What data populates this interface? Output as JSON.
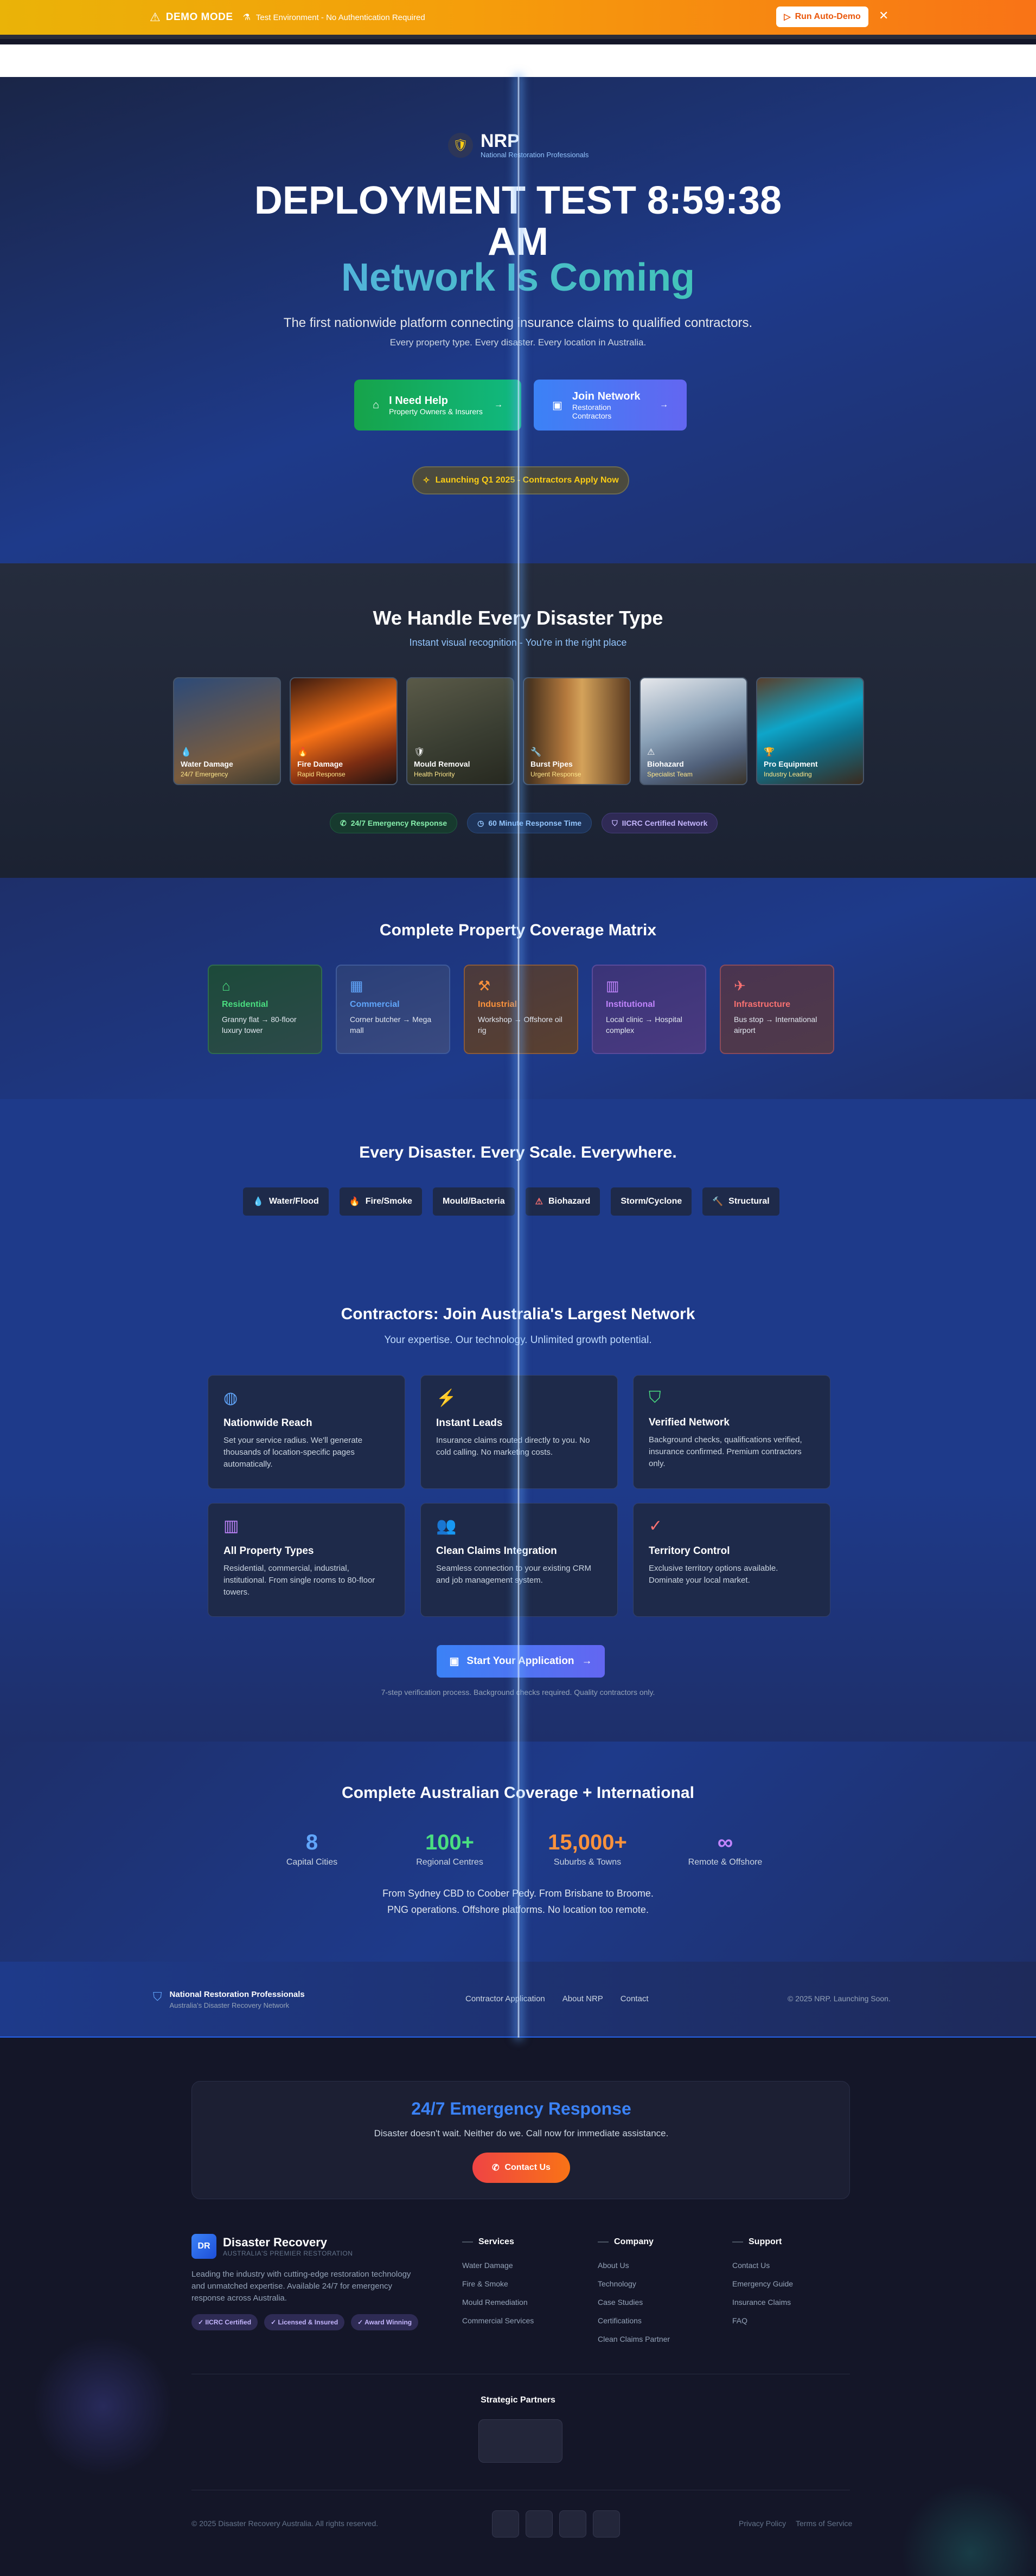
{
  "banner": {
    "mode": "DEMO MODE",
    "env": "Test Environment - No Authentication Required",
    "run_btn": "Run Auto-Demo"
  },
  "hero": {
    "logo_name": "NRP",
    "logo_sub": "National Restoration Professionals",
    "title_line1": "DEPLOYMENT TEST 8:59:38",
    "title_line2": "AM",
    "title_line3": "Network Is Coming",
    "lead": "The first nationwide platform connecting insurance claims to qualified contractors.",
    "lead2": "Every property type. Every disaster. Every location in Australia.",
    "cta1_title": "I Need Help",
    "cta1_sub": "Property Owners & Insurers",
    "cta2_title": "Join Network",
    "cta2_sub": "Restoration Contractors",
    "launch": "Launching Q1 2025 - Contractors Apply Now"
  },
  "disasters": {
    "title": "We Handle Every Disaster Type",
    "subtitle": "Instant visual recognition - You're in the right place",
    "tiles": [
      {
        "name": "Water Damage",
        "tag": "24/7 Emergency",
        "icon": "droplet-icon"
      },
      {
        "name": "Fire Damage",
        "tag": "Rapid Response",
        "icon": "flame-icon"
      },
      {
        "name": "Mould Removal",
        "tag": "Health Priority",
        "icon": "shield-icon"
      },
      {
        "name": "Burst Pipes",
        "tag": "Urgent Response",
        "icon": "wrench-icon"
      },
      {
        "name": "Biohazard",
        "tag": "Specialist Team",
        "icon": "warning-icon"
      },
      {
        "name": "Pro Equipment",
        "tag": "Industry Leading",
        "icon": "trophy-icon"
      }
    ],
    "badges": [
      "24/7 Emergency Response",
      "60 Minute Response Time",
      "IICRC Certified Network"
    ]
  },
  "matrix": {
    "title": "Complete Property Coverage Matrix",
    "cards": [
      {
        "name": "Residential",
        "desc": "Granny flat → 80-floor luxury tower"
      },
      {
        "name": "Commercial",
        "desc": "Corner butcher → Mega mall"
      },
      {
        "name": "Industrial",
        "desc": "Workshop → Offshore oil rig"
      },
      {
        "name": "Institutional",
        "desc": "Local clinic → Hospital complex"
      },
      {
        "name": "Infrastructure",
        "desc": "Bus stop → International airport"
      }
    ]
  },
  "everywhere": {
    "title": "Every Disaster. Every Scale. Everywhere.",
    "chips": [
      "Water/Flood",
      "Fire/Smoke",
      "Mould/Bacteria",
      "Biohazard",
      "Storm/Cyclone",
      "Structural"
    ]
  },
  "contractors": {
    "title": "Contractors: Join Australia's Largest Network",
    "subtitle": "Your expertise. Our technology. Unlimited growth potential.",
    "features": [
      {
        "title": "Nationwide Reach",
        "desc": "Set your service radius. We'll generate thousands of location-specific pages automatically."
      },
      {
        "title": "Instant Leads",
        "desc": "Insurance claims routed directly to you. No cold calling. No marketing costs."
      },
      {
        "title": "Verified Network",
        "desc": "Background checks, qualifications verified, insurance confirmed. Premium contractors only."
      },
      {
        "title": "All Property Types",
        "desc": "Residential, commercial, industrial, institutional. From single rooms to 80-floor towers."
      },
      {
        "title": "Clean Claims Integration",
        "desc": "Seamless connection to your existing CRM and job management system."
      },
      {
        "title": "Territory Control",
        "desc": "Exclusive territory options available. Dominate your local market."
      }
    ],
    "apply_btn": "Start Your Application",
    "note": "7-step verification process. Background checks required. Quality contractors only."
  },
  "coverage": {
    "title": "Complete Australian Coverage + International",
    "stats": [
      {
        "value": "8",
        "label": "Capital Cities",
        "color": "#60a5fa"
      },
      {
        "value": "100+",
        "label": "Regional Centres",
        "color": "#4ade80"
      },
      {
        "value": "15,000+",
        "label": "Suburbs & Towns",
        "color": "#fb923c"
      },
      {
        "value": "∞",
        "label": "Remote & Offshore",
        "color": "#c084fc"
      }
    ],
    "line1": "From Sydney CBD to Coober Pedy. From Brisbane to Broome.",
    "line2": "PNG operations. Offshore platforms. No location too remote."
  },
  "footer1": {
    "brand": "National Restoration Professionals",
    "brand_sub": "Australia's Disaster Recovery Network",
    "links": [
      "Contractor Application",
      "About NRP",
      "Contact"
    ],
    "copyright": "© 2025 NRP. Launching Soon."
  },
  "emergency": {
    "title": "24/7 Emergency Response",
    "desc": "Disaster doesn't wait. Neither do we. Call now for immediate assistance.",
    "btn": "Contact Us"
  },
  "footer2": {
    "logo_box": "DR",
    "brand": "Disaster Recovery",
    "brand_sub": "AUSTRALIA'S PREMIER RESTORATION",
    "about": "Leading the industry with cutting-edge restoration technology and unmatched expertise. Available 24/7 for emergency response across Australia.",
    "tags": [
      "✓ IICRC Certified",
      "✓ Licensed & Insured",
      "✓ Award Winning"
    ],
    "columns": [
      {
        "title": "Services",
        "items": [
          "Water Damage",
          "Fire & Smoke",
          "Mould Remediation",
          "Commercial Services"
        ]
      },
      {
        "title": "Company",
        "items": [
          "About Us",
          "Technology",
          "Case Studies",
          "Certifications",
          "Clean Claims Partner"
        ]
      },
      {
        "title": "Support",
        "items": [
          "Contact Us",
          "Emergency Guide",
          "Insurance Claims",
          "FAQ"
        ]
      }
    ],
    "partners_title": "Strategic Partners",
    "copyright": "© 2025 Disaster Recovery Australia. All rights reserved.",
    "legal": [
      "Privacy Policy",
      "Terms of Service"
    ]
  }
}
